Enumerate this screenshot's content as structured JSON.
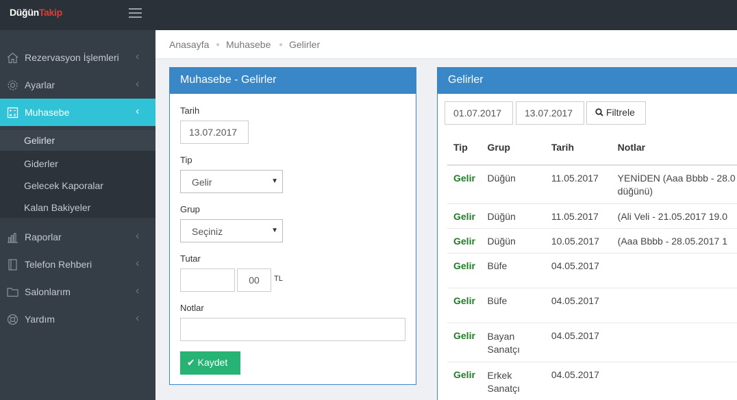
{
  "app": {
    "logo_a": "Düğün",
    "logo_b": "Takip"
  },
  "sidebar": {
    "items": [
      {
        "label": "Rezervasyon İşlemleri",
        "icon": "home-icon"
      },
      {
        "label": "Ayarlar",
        "icon": "gear-icon"
      },
      {
        "label": "Muhasebe",
        "icon": "calculator-icon"
      },
      {
        "label": "Raporlar",
        "icon": "bar-chart-icon"
      },
      {
        "label": "Telefon Rehberi",
        "icon": "phone-book-icon"
      },
      {
        "label": "Salonlarım",
        "icon": "folder-icon"
      },
      {
        "label": "Yardım",
        "icon": "help-icon"
      }
    ],
    "submenu": [
      "Gelirler",
      "Giderler",
      "Gelecek Kaporalar",
      "Kalan Bakiyeler"
    ]
  },
  "breadcrumb": [
    "Anasayfa",
    "Muhasebe",
    "Gelirler"
  ],
  "form": {
    "title": "Muhasebe - Gelirler",
    "date_label": "Tarih",
    "date_value": "13.07.2017",
    "type_label": "Tip",
    "type_value": "Gelir",
    "group_label": "Grup",
    "group_value": "Seçiniz",
    "amount_label": "Tutar",
    "amount_value": "",
    "amount_cents": "00",
    "currency": "TL",
    "notes_label": "Notlar",
    "notes_value": "",
    "save_label": "Kaydet"
  },
  "list": {
    "title": "Gelirler",
    "from_date": "01.07.2017",
    "to_date": "13.07.2017",
    "filter_label": "Filtrele",
    "columns": [
      "Tip",
      "Grup",
      "Tarih",
      "Notlar"
    ],
    "rows": [
      {
        "tip": "Gelir",
        "grup": "Düğün",
        "tarih": "11.05.2017",
        "notlar": "YENİDEN (Aaa Bbbb - 28.0 düğünü)"
      },
      {
        "tip": "Gelir",
        "grup": "Düğün",
        "tarih": "11.05.2017",
        "notlar": "(Ali Veli - 21.05.2017 19.0"
      },
      {
        "tip": "Gelir",
        "grup": "Düğün",
        "tarih": "10.05.2017",
        "notlar": "(Aaa Bbbb - 28.05.2017 1"
      },
      {
        "tip": "Gelir",
        "grup": "Büfe",
        "tarih": "04.05.2017",
        "notlar": ""
      },
      {
        "tip": "Gelir",
        "grup": "Büfe",
        "tarih": "04.05.2017",
        "notlar": ""
      },
      {
        "tip": "Gelir",
        "grup": "Bayan Sanatçı",
        "tarih": "04.05.2017",
        "notlar": ""
      },
      {
        "tip": "Gelir",
        "grup": "Erkek Sanatçı",
        "tarih": "04.05.2017",
        "notlar": ""
      }
    ]
  },
  "colors": {
    "accent": "#30c2d6",
    "panel_header": "#3a87c8",
    "save": "#26b374",
    "gelir": "#1e7d26"
  }
}
